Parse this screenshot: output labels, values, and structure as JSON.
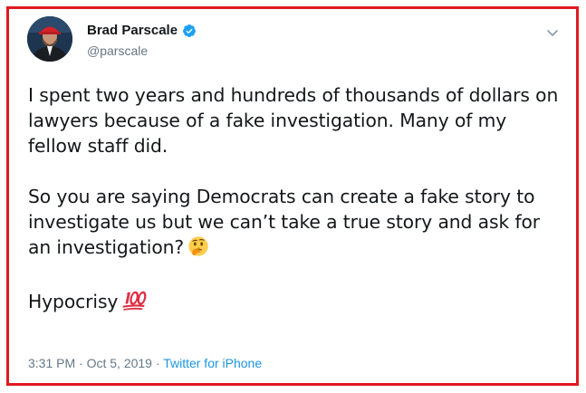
{
  "tweet": {
    "author": {
      "name": "Brad Parscale",
      "handle": "@parscale",
      "verified": true
    },
    "paragraphs": [
      {
        "text": "I spent two years and hundreds of thousands of dollars on lawyers because of a fake investigation. Many of my fellow staff did.",
        "emoji": ""
      },
      {
        "text": "So you are saying Democrats can create a fake story to investigate us but we can’t take a true story and ask for an investigation?",
        "emoji": "thinking-face-emoji"
      },
      {
        "text": "Hypocrisy",
        "emoji": "hundred-points-emoji"
      }
    ],
    "time": "3:31 PM",
    "separator_1": "·",
    "date": "Oct 5, 2019",
    "separator_2": "·",
    "source": "Twitter for iPhone"
  },
  "colors": {
    "frame_border": "#e0191f",
    "verified_badge": "#1da1f2",
    "link": "#1b95e0",
    "secondary_text": "#657786",
    "primary_text": "#14171a"
  },
  "icons": {
    "verified": "verified-badge-icon",
    "menu": "chevron-down-icon"
  }
}
